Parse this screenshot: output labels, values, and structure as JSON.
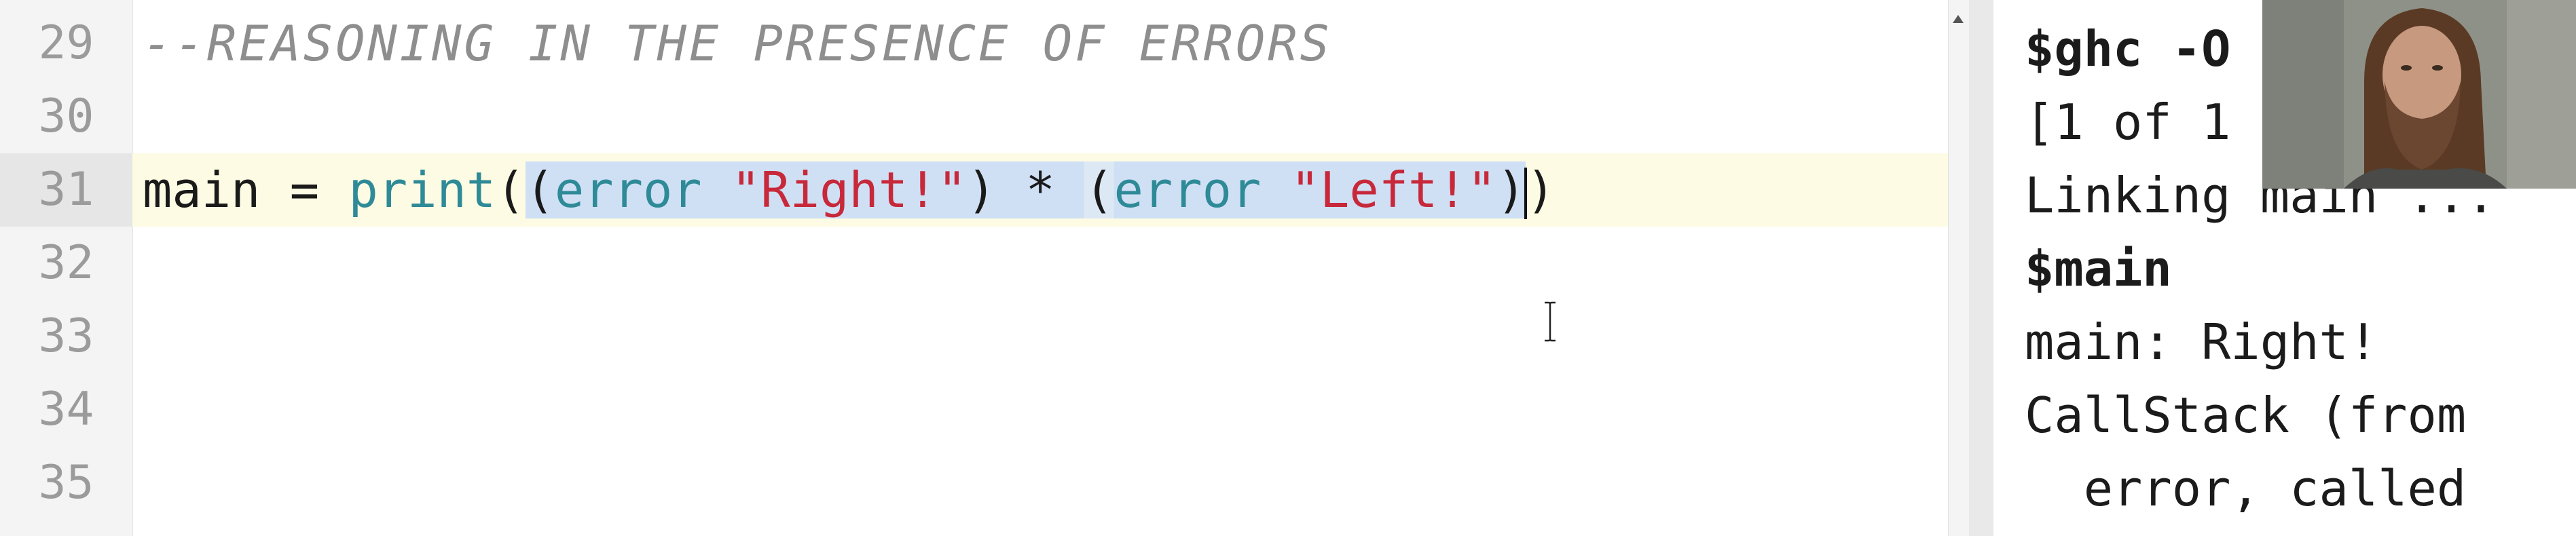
{
  "editor": {
    "lines": [
      {
        "number": "29",
        "text": "--REASONING IN THE PRESENCE OF ERRORS"
      },
      {
        "number": "30",
        "text": ""
      },
      {
        "number": "31",
        "tokens": {
          "t1": "main",
          "t2": " = ",
          "t3": "print",
          "t4": "(",
          "t5": "(",
          "t6": "error",
          "t7": " ",
          "t8": "\"Right!\"",
          "t9": ") * ",
          "t10": "(",
          "t11": "error",
          "t12": " ",
          "t13": "\"Left!\"",
          "t14": ")",
          "t15": ")"
        }
      },
      {
        "number": "32",
        "text": ""
      },
      {
        "number": "33",
        "text": ""
      },
      {
        "number": "34",
        "text": ""
      },
      {
        "number": "35",
        "text": ""
      }
    ]
  },
  "terminal": {
    "lines": [
      "$ghc -O",
      "[1 of 1",
      "Linking main ...",
      "$main",
      "main: Right!",
      "CallStack (from",
      "  error, called"
    ]
  },
  "colors": {
    "editor_bg": "#ffffff",
    "current_line_bg": "#fdfbe3",
    "selection_bg": "#cfe0f5",
    "comment": "#8e8e8e",
    "function": "#2f8a97",
    "string": "#c7293a",
    "line_number": "#9b9b9b"
  },
  "icons": {
    "scroll_up": "triangle-up",
    "cursor": "i-beam",
    "webcam": "presenter-webcam"
  }
}
